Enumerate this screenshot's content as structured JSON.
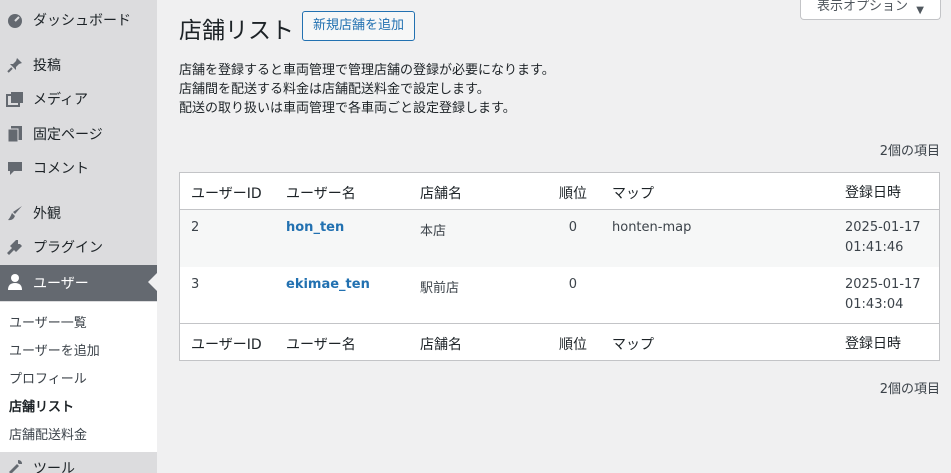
{
  "sidebar": {
    "items": [
      {
        "label": "ダッシュボード",
        "icon": "dashboard-icon"
      },
      {
        "label": "投稿",
        "icon": "pin-icon"
      },
      {
        "label": "メディア",
        "icon": "media-icon"
      },
      {
        "label": "固定ページ",
        "icon": "page-icon"
      },
      {
        "label": "コメント",
        "icon": "comment-icon"
      },
      {
        "label": "外観",
        "icon": "brush-icon"
      },
      {
        "label": "プラグイン",
        "icon": "plugin-icon"
      },
      {
        "label": "ユーザー",
        "icon": "user-icon"
      },
      {
        "label": "ツール",
        "icon": "tool-icon"
      }
    ],
    "submenu": [
      {
        "label": "ユーザー一覧"
      },
      {
        "label": "ユーザーを追加"
      },
      {
        "label": "プロフィール"
      },
      {
        "label": "店舗リスト"
      },
      {
        "label": "店舗配送料金"
      }
    ]
  },
  "header": {
    "title": "店舗リスト",
    "add_new_label": "新規店舗を追加",
    "screen_options_label": "表示オプション"
  },
  "description": [
    "店舗を登録すると車両管理で管理店舗の登録が必要になります。",
    "店舗間を配送する料金は店舗配送料金で設定します。",
    "配送の取り扱いは車両管理で各車両ごと設定登録します。"
  ],
  "item_count": "2個の項目",
  "table": {
    "columns": [
      "ユーザーID",
      "ユーザー名",
      "店舗名",
      "順位",
      "マップ",
      "登録日時"
    ],
    "rows": [
      {
        "id": "2",
        "username": "hon_ten",
        "store": "本店",
        "rank": "0",
        "map": "honten-map",
        "date": "2025-01-17",
        "time": "01:41:46"
      },
      {
        "id": "3",
        "username": "ekimae_ten",
        "store": "駅前店",
        "rank": "0",
        "map": "",
        "date": "2025-01-17",
        "time": "01:43:04"
      }
    ]
  },
  "colors": {
    "accent": "#2271b1",
    "sidebar_bg": "#dcdcde",
    "current_menu_bg": "#646970"
  }
}
